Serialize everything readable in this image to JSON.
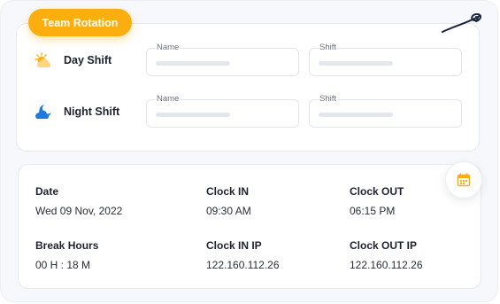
{
  "header": {
    "badge": "Team Rotation"
  },
  "rotation": {
    "day": {
      "label": "Day Shift",
      "name_label": "Name",
      "shift_label": "Shift"
    },
    "night": {
      "label": "Night Shift",
      "name_label": "Name",
      "shift_label": "Shift"
    }
  },
  "attendance": {
    "date": {
      "label": "Date",
      "value": "Wed 09 Nov, 2022"
    },
    "clock_in": {
      "label": "Clock IN",
      "value": "09:30 AM"
    },
    "clock_out": {
      "label": "Clock OUT",
      "value": "06:15 PM"
    },
    "break_hours": {
      "label": "Break Hours",
      "value": "00 H : 18 M"
    },
    "clock_in_ip": {
      "label": "Clock IN IP",
      "value": "122.160.112.26"
    },
    "clock_out_ip": {
      "label": "Clock OUT IP",
      "value": "122.160.112.26"
    }
  },
  "icons": {
    "day": "sun-cloud-icon",
    "night": "moon-cloud-icon",
    "calendar": "calendar-icon",
    "logo": "swirl-logo-icon"
  },
  "colors": {
    "accent": "#fcae0e",
    "night_icon": "#1f7ae0",
    "text": "#1f2230"
  }
}
